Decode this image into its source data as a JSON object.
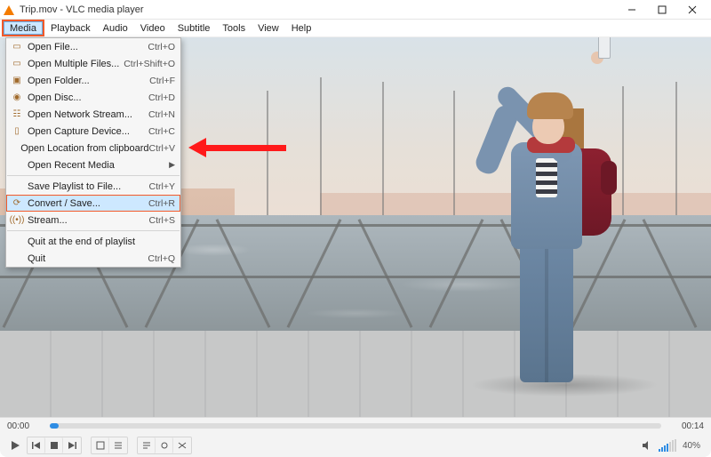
{
  "title": "Trip.mov - VLC media player",
  "menubar": [
    "Media",
    "Playback",
    "Audio",
    "Video",
    "Subtitle",
    "Tools",
    "View",
    "Help"
  ],
  "menu": {
    "items": [
      {
        "icon": "file",
        "label": "Open File...",
        "shortcut": "Ctrl+O"
      },
      {
        "icon": "files",
        "label": "Open Multiple Files...",
        "shortcut": "Ctrl+Shift+O"
      },
      {
        "icon": "folder",
        "label": "Open Folder...",
        "shortcut": "Ctrl+F"
      },
      {
        "icon": "disc",
        "label": "Open Disc...",
        "shortcut": "Ctrl+D"
      },
      {
        "icon": "network",
        "label": "Open Network Stream...",
        "shortcut": "Ctrl+N"
      },
      {
        "icon": "capture",
        "label": "Open Capture Device...",
        "shortcut": "Ctrl+C"
      },
      {
        "icon": "",
        "label": "Open Location from clipboard",
        "shortcut": "Ctrl+V"
      },
      {
        "icon": "",
        "label": "Open Recent Media",
        "shortcut": "",
        "submenu": true
      }
    ],
    "items2": [
      {
        "icon": "",
        "label": "Save Playlist to File...",
        "shortcut": "Ctrl+Y"
      },
      {
        "icon": "convert",
        "label": "Convert / Save...",
        "shortcut": "Ctrl+R",
        "highlight": true
      },
      {
        "icon": "stream",
        "label": "Stream...",
        "shortcut": "Ctrl+S"
      }
    ],
    "items3": [
      {
        "icon": "",
        "label": "Quit at the end of playlist",
        "shortcut": ""
      },
      {
        "icon": "",
        "label": "Quit",
        "shortcut": "Ctrl+Q"
      }
    ]
  },
  "time": {
    "cur": "00:00",
    "dur": "00:14"
  },
  "volume": "40%"
}
